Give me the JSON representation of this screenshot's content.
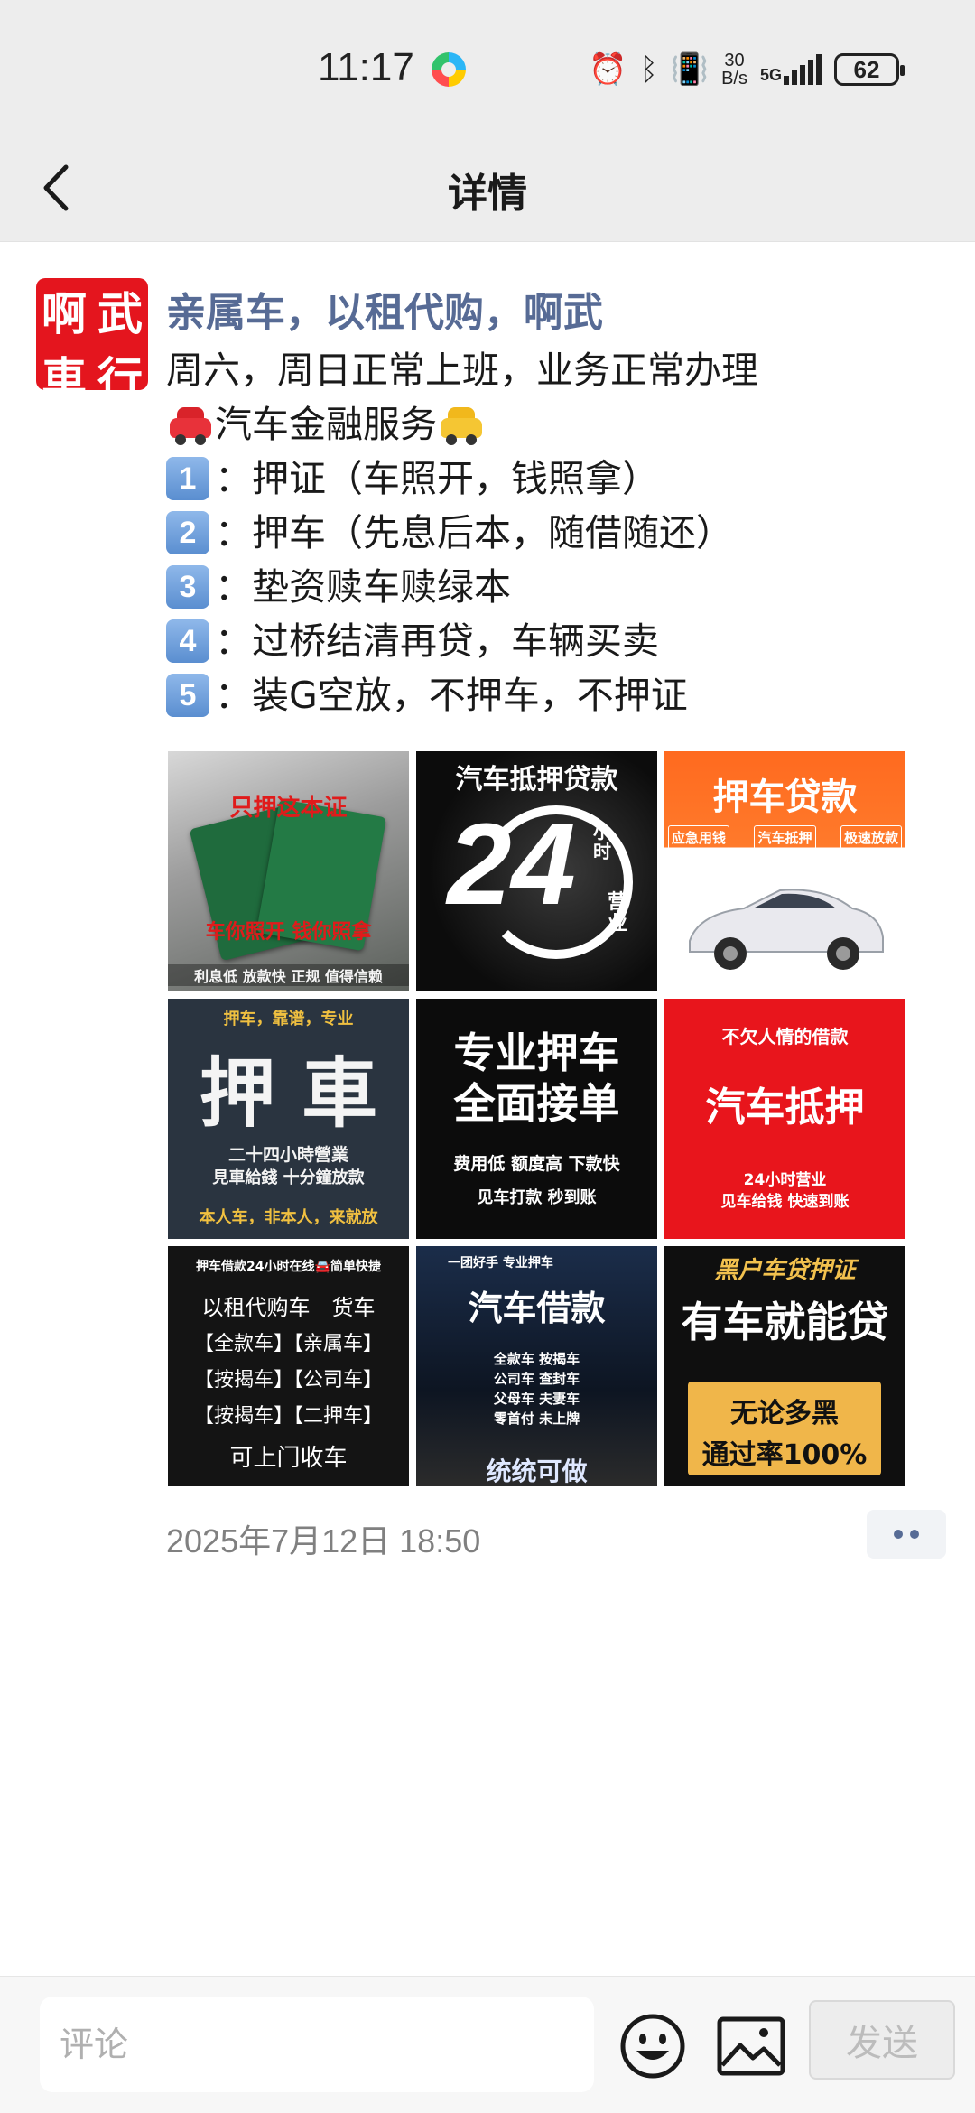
{
  "status_bar": {
    "time": "11:17",
    "net_rate_value": "30",
    "net_rate_unit": "B/s",
    "network": "5G",
    "battery": "62"
  },
  "header": {
    "title": "详情",
    "back_icon": "chevron-left-icon"
  },
  "post": {
    "avatar_chars": [
      "啊",
      "武",
      "車",
      "行"
    ],
    "poster_name": "亲属车，以租代购，啊武",
    "line1": "周六，周日正常上班，业务正常办理",
    "service_title": "汽车金融服务",
    "items": [
      {
        "num": "1",
        "text": "：押证（车照开，钱照拿）"
      },
      {
        "num": "2",
        "text": "：押车（先息后本，随借随还）"
      },
      {
        "num": "3",
        "text": "：垫资赎车赎绿本"
      },
      {
        "num": "4",
        "text": "：过桥结清再贷，车辆买卖"
      },
      {
        "num": "5",
        "text": "：装G空放，不押车，不押证"
      }
    ],
    "images": {
      "img1": {
        "top": "只押这本证",
        "middle": "车你照开 钱你照拿",
        "bottom": "利息低 放款快 正规 值得信赖"
      },
      "img2": {
        "top": "汽车抵押贷款",
        "big": "24",
        "side1": "小时",
        "side2": "营业"
      },
      "img3": {
        "title": "押车贷款",
        "tags": [
          "应急用钱",
          "汽车抵押",
          "极速放款"
        ]
      },
      "img4": {
        "top": "押车，靠谱，专业",
        "big": "押 車",
        "line1": "二十四小時營業",
        "line2": "見車給錢 十分鐘放款",
        "bottom": "本人车，非本人，来就放"
      },
      "img5": {
        "line1": "专业押车",
        "line2": "全面接单",
        "sub1": "费用低 额度高 下款快",
        "sub2": "见车打款 秒到账"
      },
      "img6": {
        "top": "不欠人情的借款",
        "big": "汽车抵押",
        "sub1": "24小时营业",
        "sub2": "见车给钱 快速到账"
      },
      "img7": {
        "top": "押车借款24小时在线🚘简单快捷",
        "line1": "以租代购车　货车",
        "line2": "【全款车】【亲属车】",
        "line3": "【按揭车】【公司车】",
        "line4": "【按揭车】【二押车】",
        "bottom": "可上门收车"
      },
      "img8": {
        "top": "一团好手 专业押车",
        "big": "汽车借款",
        "rows": [
          "全款车 按揭车",
          "公司车 查封车",
          "父母车 夫妻车",
          "零首付 未上牌"
        ],
        "bottom": "统统可做"
      },
      "img9": {
        "top": "黑户车贷押证",
        "big": "有车就能贷",
        "box1": "无论多黑",
        "box2": "通过率100%"
      }
    },
    "timestamp": "2025年7月12日 18:50"
  },
  "bottom_bar": {
    "comment_placeholder": "评论",
    "send_label": "发送",
    "emoji_icon": "smiley-icon",
    "image_icon": "image-icon"
  },
  "colors": {
    "link_blue": "#576b95",
    "header_bg": "#ededed",
    "avatar_red": "#e4151e"
  }
}
